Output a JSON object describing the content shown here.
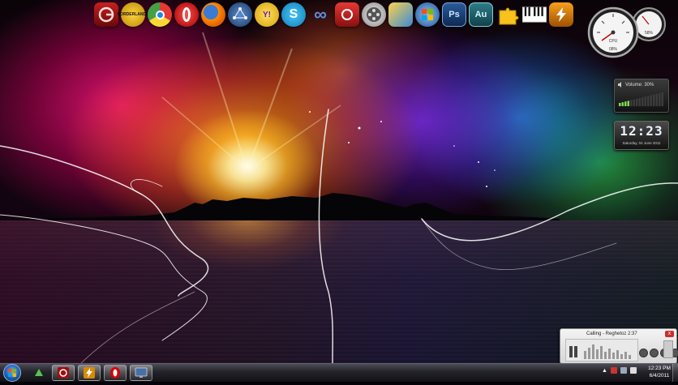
{
  "dock": {
    "icons": [
      {
        "name": "garena",
        "label": "",
        "color": "#9b1010"
      },
      {
        "name": "borderlands",
        "label": "BORDERLANDS",
        "color": "#c7a000"
      },
      {
        "name": "chrome",
        "label": "",
        "color": "#2f9e44"
      },
      {
        "name": "opera",
        "label": "",
        "color": "#d40000"
      },
      {
        "name": "firefox",
        "label": "",
        "color": "#e66000"
      },
      {
        "name": "network",
        "label": "",
        "color": "#3a5a8a"
      },
      {
        "name": "yahoo-messenger",
        "label": "Y!",
        "color": "#6b1aa6"
      },
      {
        "name": "skype",
        "label": "S",
        "color": "#11a3e0"
      },
      {
        "name": "infinity",
        "label": "∞",
        "color": "#2a5aa6"
      },
      {
        "name": "photo-booth",
        "label": "",
        "color": "#c22"
      },
      {
        "name": "film-reel",
        "label": "",
        "color": "#888"
      },
      {
        "name": "media-tools",
        "label": "",
        "color": "#d7a21c"
      },
      {
        "name": "windows-flag",
        "label": "",
        "color": "#2e6eb5"
      },
      {
        "name": "photoshop",
        "label": "Ps",
        "color": "#1c3f6e"
      },
      {
        "name": "audition",
        "label": "Au",
        "color": "#1e5560"
      },
      {
        "name": "puzzle",
        "label": "",
        "color": "#f2b400"
      },
      {
        "name": "piano",
        "label": "",
        "color": "#333"
      },
      {
        "name": "winamp",
        "label": "",
        "color": "#c26a00"
      }
    ]
  },
  "volume_gadget": {
    "label": "Volume: 30%",
    "level": 0.3
  },
  "clock_gadget": {
    "time": "12:23",
    "date": "Saturday, 04 June 2011"
  },
  "cpu_gauge": {
    "label": "CPU",
    "value": "08%",
    "ram": "58%"
  },
  "media_player": {
    "title": "Calling - Reghetoz   2:37",
    "close": "x"
  },
  "taskbar": {
    "buttons": [
      {
        "name": "utorrent",
        "color": "#3ca43c"
      },
      {
        "name": "garena",
        "color": "#9b1010"
      },
      {
        "name": "winamp",
        "color": "#c26a00"
      },
      {
        "name": "opera",
        "color": "#d40000"
      },
      {
        "name": "monitor",
        "color": "#4a6fa5"
      }
    ],
    "clock": {
      "time": "12:23 PM",
      "date": "6/4/2011"
    }
  }
}
